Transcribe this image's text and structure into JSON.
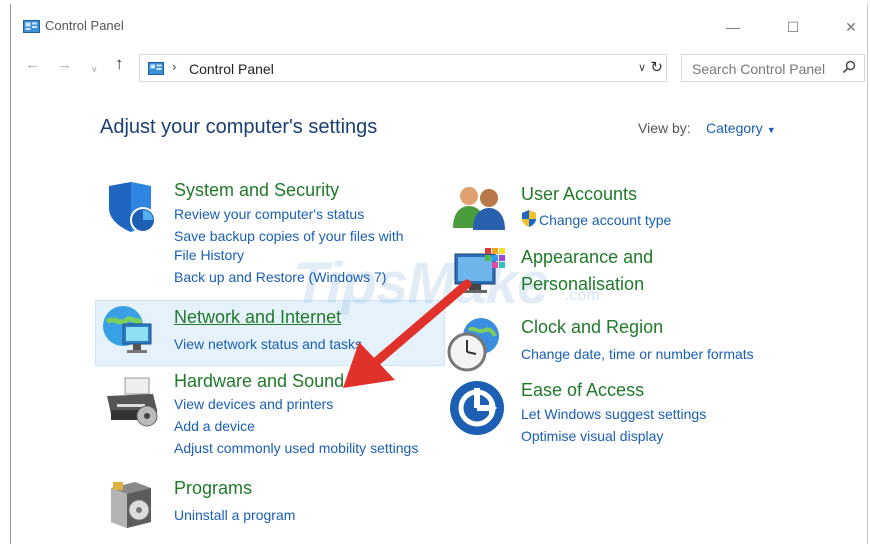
{
  "window": {
    "title": "Control Panel"
  },
  "address_bar": {
    "path": "Control Panel"
  },
  "search": {
    "placeholder": "Search Control Panel"
  },
  "page": {
    "heading": "Adjust your computer's settings",
    "view_by_label": "View by:",
    "view_by_value": "Category"
  },
  "watermark": {
    "text": "TipsMake",
    "suffix": ".com"
  },
  "categories": {
    "system_security": {
      "title": "System and Security",
      "links": [
        "Review your computer's status",
        "Save backup copies of your files with",
        "File History",
        "Back up and Restore (Windows 7)"
      ]
    },
    "network": {
      "title": "Network and Internet",
      "links": [
        "View network status and tasks"
      ]
    },
    "hardware": {
      "title": "Hardware and Sound",
      "links": [
        "View devices and printers",
        "Add a device",
        "Adjust commonly used mobility settings"
      ]
    },
    "programs": {
      "title": "Programs",
      "links": [
        "Uninstall a program"
      ]
    },
    "user_accounts": {
      "title": "User Accounts",
      "links": [
        "Change account type"
      ]
    },
    "appearance": {
      "title_line1": "Appearance and",
      "title_line2": "Personalisation"
    },
    "clock": {
      "title": "Clock and Region",
      "links": [
        "Change date, time or number formats"
      ]
    },
    "ease": {
      "title": "Ease of Access",
      "links": [
        "Let Windows suggest settings",
        "Optimise visual display"
      ]
    }
  },
  "colors": {
    "title_green": "#207a2a",
    "link_blue": "#1a5fb4",
    "heading_blue": "#1b3f73",
    "arrow_red": "#e0322b",
    "highlight_bg": "#e6f2fb"
  },
  "icons": [
    "control-panel-icon",
    "back-arrow-icon",
    "forward-arrow-icon",
    "up-arrow-icon",
    "refresh-icon",
    "search-icon",
    "shield-icon",
    "network-globe-icon",
    "printer-icon",
    "programs-box-icon",
    "users-icon",
    "appearance-monitor-icon",
    "clock-icon",
    "ease-of-access-icon",
    "uac-shield-icon",
    "red-arrow-icon"
  ]
}
